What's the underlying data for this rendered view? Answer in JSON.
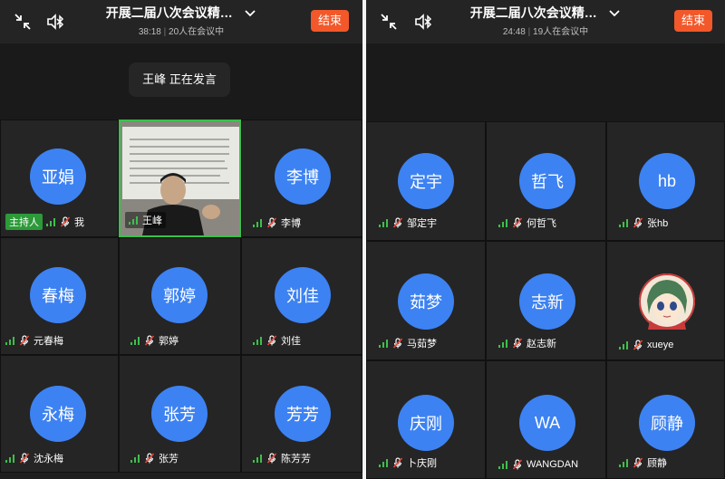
{
  "left": {
    "title": "开展二届八次会议精…",
    "duration": "38:18",
    "status": "20人在会议中",
    "end_label": "结束",
    "speaking_name": "王峰",
    "speaking_text": "正在发言",
    "host_badge": "主持人",
    "tiles": [
      {
        "avatar": "亚娟",
        "name": "我"
      },
      {
        "avatar": "",
        "name": "王峰"
      },
      {
        "avatar": "李博",
        "name": "李博"
      },
      {
        "avatar": "春梅",
        "name": "元春梅"
      },
      {
        "avatar": "郭婷",
        "name": "郭婷"
      },
      {
        "avatar": "刘佳",
        "name": "刘佳"
      },
      {
        "avatar": "永梅",
        "name": "沈永梅"
      },
      {
        "avatar": "张芳",
        "name": "张芳"
      },
      {
        "avatar": "芳芳",
        "name": "陈芳芳"
      }
    ]
  },
  "right": {
    "title": "开展二届八次会议精…",
    "duration": "24:48",
    "status": "19人在会议中",
    "end_label": "结束",
    "tiles": [
      {
        "avatar": "定宇",
        "name": "邹定宇"
      },
      {
        "avatar": "哲飞",
        "name": "何哲飞"
      },
      {
        "avatar": "hb",
        "name": "张hb"
      },
      {
        "avatar": "茹梦",
        "name": "马茹梦"
      },
      {
        "avatar": "志新",
        "name": "赵志新"
      },
      {
        "avatar": "",
        "name": "xueye"
      },
      {
        "avatar": "庆刚",
        "name": "卜庆刚"
      },
      {
        "avatar": "WA",
        "name": "WANGDAN"
      },
      {
        "avatar": "顾静",
        "name": "顾静"
      }
    ]
  },
  "icons": {
    "collapse": "collapse-icon",
    "bluetooth_audio": "bluetooth-speaker-icon",
    "chevron": "chevron-down-icon",
    "signal": "signal-icon",
    "mic_muted": "mic-muted-icon"
  },
  "colors": {
    "avatar": "#3d82f2",
    "end_button": "#f2582a",
    "host_badge": "#2d9a3a",
    "active_speaker_border": "#38c24a"
  }
}
